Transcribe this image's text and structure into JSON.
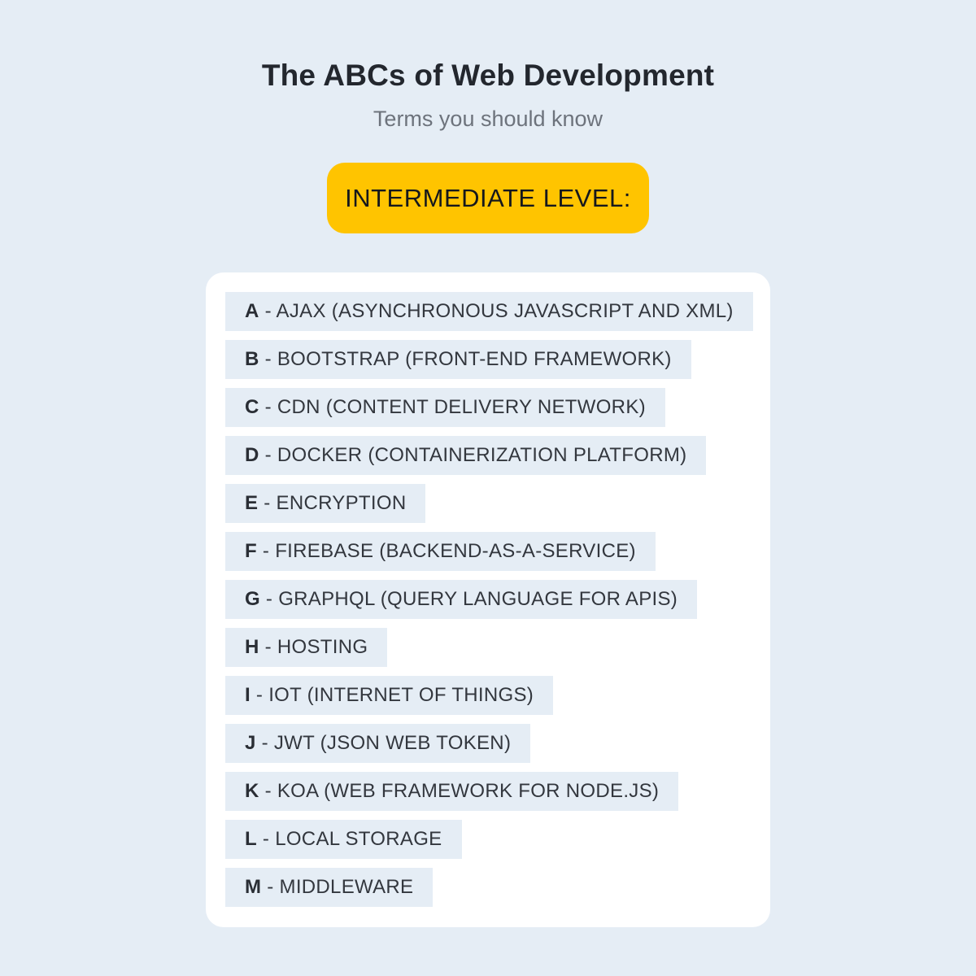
{
  "header": {
    "title": "The ABCs of Web Development",
    "subtitle": "Terms you should know"
  },
  "badge": {
    "label": "INTERMEDIATE LEVEL:"
  },
  "colors": {
    "background": "#e5edf5",
    "badge": "#ffc400",
    "card": "#ffffff",
    "item_background": "#e5edf5"
  },
  "terms": [
    {
      "letter": "A",
      "text": " - AJAX (ASYNCHRONOUS JAVASCRIPT AND XML)"
    },
    {
      "letter": "B",
      "text": " - BOOTSTRAP (FRONT-END FRAMEWORK)"
    },
    {
      "letter": "C",
      "text": " - CDN (CONTENT DELIVERY NETWORK)"
    },
    {
      "letter": "D",
      "text": " - DOCKER (CONTAINERIZATION PLATFORM)"
    },
    {
      "letter": "E",
      "text": " - ENCRYPTION"
    },
    {
      "letter": "F",
      "text": " - FIREBASE (BACKEND-AS-A-SERVICE)"
    },
    {
      "letter": "G",
      "text": " - GRAPHQL (QUERY LANGUAGE FOR APIS)"
    },
    {
      "letter": "H",
      "text": " - HOSTING"
    },
    {
      "letter": "I",
      "text": " - IOT (INTERNET OF THINGS)"
    },
    {
      "letter": "J",
      "text": " - JWT (JSON WEB TOKEN)"
    },
    {
      "letter": "K",
      "text": " - KOA (WEB FRAMEWORK FOR NODE.JS)"
    },
    {
      "letter": "L",
      "text": " - LOCAL STORAGE"
    },
    {
      "letter": "M",
      "text": " - MIDDLEWARE"
    }
  ]
}
